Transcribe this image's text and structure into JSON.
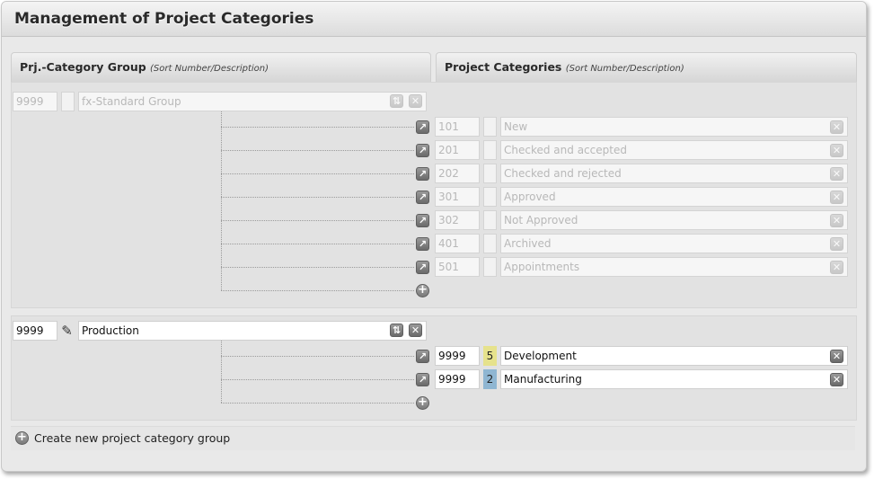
{
  "title": "Management of Project Categories",
  "columns": {
    "groups": {
      "label": "Prj.-Category Group",
      "hint": "(Sort Number/Description)"
    },
    "categories": {
      "label": "Project Categories",
      "hint": "(Sort Number/Description)"
    }
  },
  "groups": [
    {
      "sort": "9999",
      "name": "fx-Standard Group",
      "categories": [
        {
          "sort": "101",
          "name": "New",
          "badge": ""
        },
        {
          "sort": "201",
          "name": "Checked and accepted",
          "badge": ""
        },
        {
          "sort": "202",
          "name": "Checked and rejected",
          "badge": ""
        },
        {
          "sort": "301",
          "name": "Approved",
          "badge": ""
        },
        {
          "sort": "302",
          "name": "Not Approved",
          "badge": ""
        },
        {
          "sort": "401",
          "name": "Archived",
          "badge": ""
        },
        {
          "sort": "501",
          "name": "Appointments",
          "badge": ""
        }
      ]
    },
    {
      "sort": "9999",
      "name": "Production",
      "categories": [
        {
          "sort": "9999",
          "name": "Development",
          "badge": "5",
          "badge_color": "#e6e28c"
        },
        {
          "sort": "9999",
          "name": "Manufacturing",
          "badge": "2",
          "badge_color": "#8fb6d2"
        }
      ]
    }
  ],
  "create_group_label": "Create new project category group",
  "icons": {
    "move": "move-arrow-icon",
    "delete": "close-icon",
    "add": "plus-icon",
    "sort_updown": "updown-arrow-icon",
    "edit": "pencil-icon"
  }
}
